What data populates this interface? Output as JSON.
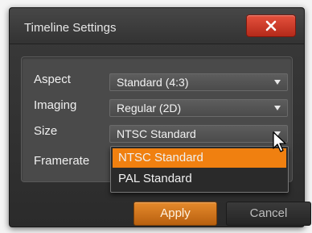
{
  "window": {
    "title": "Timeline Settings",
    "close_icon": "close-icon"
  },
  "settings": {
    "aspect": {
      "label": "Aspect",
      "value": "Standard (4:3)"
    },
    "imaging": {
      "label": "Imaging",
      "value": "Regular (2D)"
    },
    "size": {
      "label": "Size",
      "value": "NTSC Standard"
    },
    "framerate": {
      "label": "Framerate"
    }
  },
  "size_dropdown": {
    "options": [
      "NTSC Standard",
      "PAL Standard"
    ],
    "highlighted": "NTSC Standard"
  },
  "buttons": {
    "apply": "Apply",
    "cancel": "Cancel"
  },
  "colors": {
    "accent": "#f08010",
    "close": "#d0402c",
    "background": "#2e2e2e"
  }
}
